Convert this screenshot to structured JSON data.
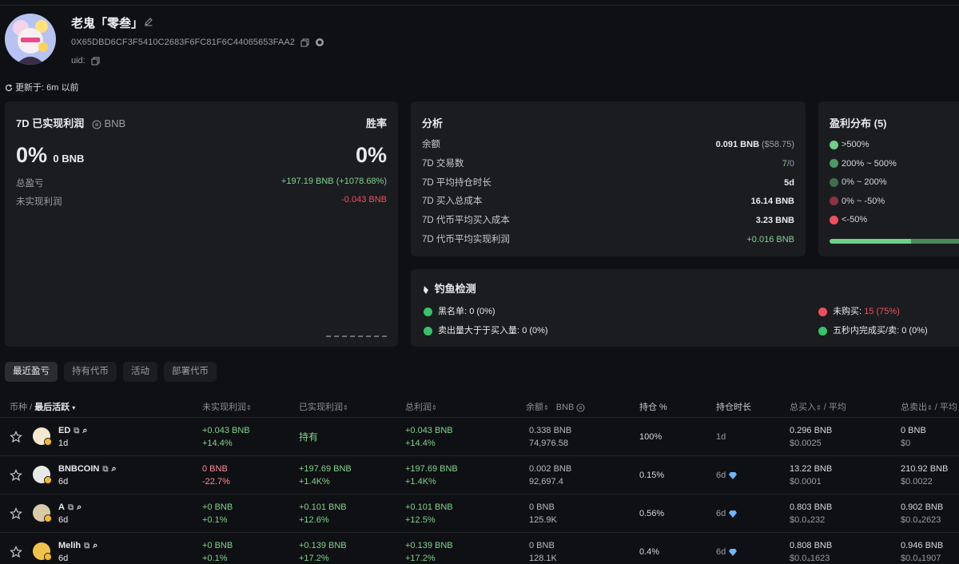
{
  "profile": {
    "name": "老鬼「零叁」",
    "address": "0X65DBD6CF3F5410C2683F6FC81F6C44065653FAA2",
    "uid_label": "uid:",
    "updated": "更新于: 6m 以前"
  },
  "pnl_card": {
    "title": "7D 已实现利润",
    "currency": "BNB",
    "winrate_label": "胜率",
    "pnl_percent": "0%",
    "pnl_bnb": "0 BNB",
    "winrate": "0%",
    "total_pnl_label": "总盈亏",
    "total_pnl_value": "+197.19 BNB (+1078.68%)",
    "unrealized_label": "未实现利润",
    "unrealized_value": "-0.043 BNB"
  },
  "analysis": {
    "title": "分析",
    "rows": [
      {
        "label": "余额",
        "value": "0.091 BNB",
        "extra": "($58.75)"
      },
      {
        "label": "7D 交易数",
        "value": "7",
        "extra": "/0"
      },
      {
        "label": "7D 平均持仓时长",
        "value": "5d"
      },
      {
        "label": "7D 买入总成本",
        "value": "16.14 BNB"
      },
      {
        "label": "7D 代币平均买入成本",
        "value": "3.23 BNB"
      },
      {
        "label": "7D 代币平均实现利润",
        "value": "+0.016 BNB"
      }
    ]
  },
  "distribution": {
    "title": "盈利分布 (5)",
    "items": [
      {
        "label": ">500%",
        "color": "#6fcf86"
      },
      {
        "label": "200% ~ 500%",
        "color": "#4f9a62"
      },
      {
        "label": "0% ~ 200%",
        "color": "#3f6e4a"
      },
      {
        "label": "0% ~ -50%",
        "color": "#8a3440"
      },
      {
        "label": "<-50%",
        "color": "#f04f5e"
      }
    ],
    "bar_fractions": [
      0.58,
      0.42
    ]
  },
  "phishing": {
    "title": "钓鱼检测",
    "blacklist_label": "黑名单:",
    "blacklist_value": "0 (0%)",
    "not_bought_label": "未购买:",
    "not_bought_value": "15 (75%)",
    "sold_gt_bought_label": "卖出量大于于买入量:",
    "sold_gt_bought_value": "0 (0%)",
    "fast_trade_label": "五秒内完成买/卖:",
    "fast_trade_value": "0 (0%)"
  },
  "tabs": [
    "最近盈亏",
    "持有代币",
    "活动",
    "部署代币"
  ],
  "table": {
    "headers": {
      "coin": "币种",
      "sep": "/",
      "last_active": "最后活跃",
      "unrealized": "未实现利润",
      "realized": "已实现利润",
      "total": "总利润",
      "balance": "余额",
      "balance_unit": "BNB",
      "holding_pct": "持仓 %",
      "holding_time": "持仓时长",
      "total_buy": "总买入",
      "avg": "/ 平均",
      "total_sell": "总卖出",
      "avg2": "/ 平均"
    },
    "rows": [
      {
        "symbol": "ED",
        "age": "1d",
        "unreal_bnb": "+0.043 BNB",
        "unreal_pct": "+14.4%",
        "realized_bnb": "持有",
        "realized_pct": "",
        "total_bnb": "+0.043 BNB",
        "total_pct": "+14.4%",
        "bal_bnb": "0.338 BNB",
        "bal_amt": "74,976.58",
        "hold_pct": "100%",
        "hold_time": "1d",
        "gem": false,
        "buy": "0.296 BNB",
        "buy_avg": "$0.0025",
        "sell": "0 BNB",
        "sell_avg": "$0",
        "coin_color": "#f5ead0"
      },
      {
        "symbol": "BNBCOIN",
        "age": "6d",
        "unreal_bnb": "0 BNB",
        "unreal_pct": "-22.7%",
        "realized_bnb": "+197.69 BNB",
        "realized_pct": "+1.4K%",
        "total_bnb": "+197.69 BNB",
        "total_pct": "+1.4K%",
        "bal_bnb": "0.002 BNB",
        "bal_amt": "92,697.4",
        "hold_pct": "0.15%",
        "hold_time": "6d",
        "gem": true,
        "buy": "13.22 BNB",
        "buy_avg": "$0.0001",
        "sell": "210.92 BNB",
        "sell_avg": "$0.0022",
        "coin_color": "#e8e8e8"
      },
      {
        "symbol": "A",
        "age": "6d",
        "unreal_bnb": "+0 BNB",
        "unreal_pct": "+0.1%",
        "realized_bnb": "+0.101 BNB",
        "realized_pct": "+12.6%",
        "total_bnb": "+0.101 BNB",
        "total_pct": "+12.5%",
        "bal_bnb": "0 BNB",
        "bal_amt": "125.9K",
        "hold_pct": "0.56%",
        "hold_time": "6d",
        "gem": true,
        "buy": "0.803 BNB",
        "buy_avg": "$0.0₄232",
        "sell": "0.902 BNB",
        "sell_avg": "$0.0₄2623",
        "coin_color": "#d8c9a8"
      },
      {
        "symbol": "Melih",
        "age": "6d",
        "unreal_bnb": "+0 BNB",
        "unreal_pct": "+0.1%",
        "realized_bnb": "+0.139 BNB",
        "realized_pct": "+17.2%",
        "total_bnb": "+0.139 BNB",
        "total_pct": "+17.2%",
        "bal_bnb": "0 BNB",
        "bal_amt": "128.1K",
        "hold_pct": "0.4%",
        "hold_time": "6d",
        "gem": true,
        "buy": "0.808 BNB",
        "buy_avg": "$0.0₄1623",
        "sell": "0.946 BNB",
        "sell_avg": "$0.0₄1907",
        "coin_color": "#f0c24a"
      }
    ]
  }
}
